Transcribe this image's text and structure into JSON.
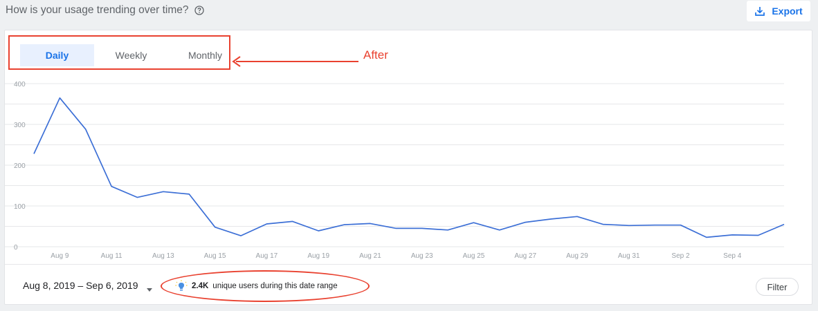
{
  "header": {
    "title": "How is your usage trending over time?",
    "help_icon": "help-circle-icon",
    "export_label": "Export",
    "export_icon": "download-icon"
  },
  "tabs": [
    {
      "label": "Daily",
      "active": true
    },
    {
      "label": "Weekly",
      "active": false
    },
    {
      "label": "Monthly",
      "active": false
    }
  ],
  "annotation": {
    "label": "After",
    "color": "#e9412f"
  },
  "footer": {
    "date_range": "Aug 8, 2019 – Sep 6, 2019",
    "users_icon": "lightbulb-icon",
    "users_count": "2.4K",
    "users_text": "unique users during this date range",
    "filter_label": "Filter"
  },
  "colors": {
    "accent": "#1a73e8",
    "line": "#3c6fd6",
    "annotation": "#e9412f"
  },
  "chart_data": {
    "type": "line",
    "title": "",
    "xlabel": "",
    "ylabel": "",
    "ylim": [
      0,
      400
    ],
    "yticks": [
      0,
      100,
      200,
      300,
      400
    ],
    "grid": true,
    "x_tick_labels": [
      {
        "date": "2019-08-09",
        "label": "Aug 9"
      },
      {
        "date": "2019-08-11",
        "label": "Aug 11"
      },
      {
        "date": "2019-08-13",
        "label": "Aug 13"
      },
      {
        "date": "2019-08-15",
        "label": "Aug 15"
      },
      {
        "date": "2019-08-17",
        "label": "Aug 17"
      },
      {
        "date": "2019-08-19",
        "label": "Aug 19"
      },
      {
        "date": "2019-08-21",
        "label": "Aug 21"
      },
      {
        "date": "2019-08-23",
        "label": "Aug 23"
      },
      {
        "date": "2019-08-25",
        "label": "Aug 25"
      },
      {
        "date": "2019-08-27",
        "label": "Aug 27"
      },
      {
        "date": "2019-08-29",
        "label": "Aug 29"
      },
      {
        "date": "2019-08-31",
        "label": "Aug 31"
      },
      {
        "date": "2019-09-02",
        "label": "Sep 2"
      },
      {
        "date": "2019-09-04",
        "label": "Sep 4"
      }
    ],
    "series": [
      {
        "x": [
          "2019-08-08",
          "2019-08-09",
          "2019-08-10",
          "2019-08-11",
          "2019-08-12",
          "2019-08-13",
          "2019-08-14",
          "2019-08-15",
          "2019-08-16",
          "2019-08-17",
          "2019-08-18",
          "2019-08-19",
          "2019-08-20",
          "2019-08-21",
          "2019-08-22",
          "2019-08-23",
          "2019-08-24",
          "2019-08-25",
          "2019-08-26",
          "2019-08-27",
          "2019-08-28",
          "2019-08-29",
          "2019-08-30",
          "2019-08-31",
          "2019-09-01",
          "2019-09-02",
          "2019-09-03",
          "2019-09-04",
          "2019-09-05",
          "2019-09-06"
        ],
        "values": [
          228,
          365,
          288,
          148,
          121,
          135,
          129,
          48,
          27,
          56,
          62,
          39,
          54,
          57,
          45,
          45,
          41,
          59,
          41,
          60,
          68,
          74,
          55,
          52,
          53,
          53,
          23,
          29,
          28,
          55
        ]
      }
    ]
  }
}
